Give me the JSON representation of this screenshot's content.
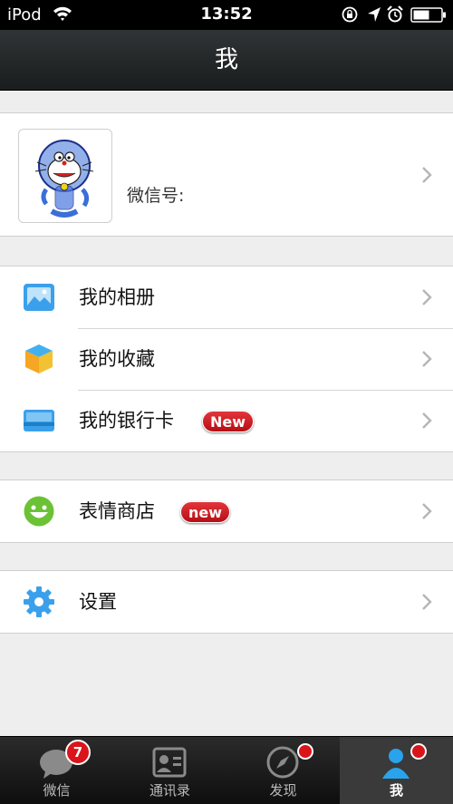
{
  "status_bar": {
    "carrier": "iPod",
    "time": "13:52"
  },
  "nav": {
    "title": "我"
  },
  "profile": {
    "name": "",
    "wechat_id_label": "微信号:"
  },
  "menu_groups": [
    [
      {
        "label": "我的相册",
        "icon": "album-icon",
        "badge": ""
      },
      {
        "label": "我的收藏",
        "icon": "favorites-icon",
        "badge": ""
      },
      {
        "label": "我的银行卡",
        "icon": "bankcard-icon",
        "badge": "New"
      }
    ],
    [
      {
        "label": "表情商店",
        "icon": "sticker-shop-icon",
        "badge": "new"
      }
    ],
    [
      {
        "label": "设置",
        "icon": "settings-icon",
        "badge": ""
      }
    ]
  ],
  "tabs": [
    {
      "label": "微信",
      "icon": "chats-icon",
      "badge": "7",
      "active": false
    },
    {
      "label": "通讯录",
      "icon": "contacts-icon",
      "badge": "",
      "active": false
    },
    {
      "label": "发现",
      "icon": "discover-icon",
      "badge": "dot",
      "active": false
    },
    {
      "label": "我",
      "icon": "me-icon",
      "badge": "dot",
      "active": true
    }
  ],
  "colors": {
    "badge_red": "#d9141b",
    "nav_bg": "#1f2324",
    "page_bg": "#eeeeee"
  }
}
